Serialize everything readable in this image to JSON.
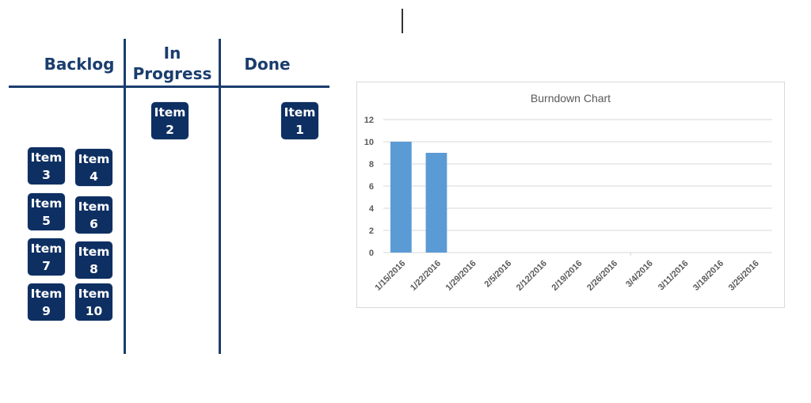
{
  "board": {
    "columns": [
      {
        "key": "backlog",
        "title": "Backlog"
      },
      {
        "key": "in_progress",
        "title_line1": "In",
        "title_line2": "Progress"
      },
      {
        "key": "done",
        "title": "Done"
      }
    ],
    "cards": [
      {
        "label": "Item",
        "number": "2",
        "column": "in_progress"
      },
      {
        "label": "Item",
        "number": "1",
        "column": "done"
      },
      {
        "label": "Item",
        "number": "3",
        "column": "backlog"
      },
      {
        "label": "Item",
        "number": "4",
        "column": "backlog"
      },
      {
        "label": "Item",
        "number": "5",
        "column": "backlog"
      },
      {
        "label": "Item",
        "number": "6",
        "column": "backlog"
      },
      {
        "label": "Item",
        "number": "7",
        "column": "backlog"
      },
      {
        "label": "Item",
        "number": "8",
        "column": "backlog"
      },
      {
        "label": "Item",
        "number": "9",
        "column": "backlog"
      },
      {
        "label": "Item",
        "number": "10",
        "column": "backlog"
      }
    ]
  },
  "colors": {
    "board_accent": "#1a3d6e",
    "card_fill": "#0e2f62",
    "bar_fill": "#5b9bd5",
    "gridline": "#d9d9d9",
    "axis_text": "#595959"
  },
  "chart_data": {
    "type": "bar",
    "title": "Burndown Chart",
    "xlabel": "",
    "ylabel": "",
    "categories": [
      "1/15/2016",
      "1/22/2016",
      "1/29/2016",
      "2/5/2016",
      "2/12/2016",
      "2/19/2016",
      "2/26/2016",
      "3/4/2016",
      "3/11/2016",
      "3/18/2016",
      "3/25/2016"
    ],
    "values": [
      10,
      9,
      null,
      null,
      null,
      null,
      null,
      null,
      null,
      null,
      null
    ],
    "ylim": [
      0,
      12
    ],
    "yticks": [
      0,
      2,
      4,
      6,
      8,
      10,
      12
    ],
    "grid": true,
    "legend": "none"
  }
}
